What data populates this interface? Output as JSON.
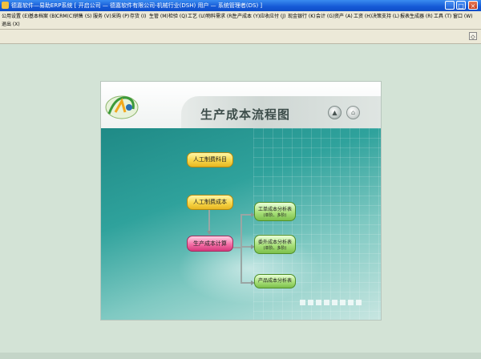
{
  "window": {
    "title": "德嘉软件—易助ERP系统   [ 开启公司 — 德嘉软件有限公司-机械行业(DSH)    用户 — 系统管理者(DS) ]",
    "buttons": [
      "_",
      "□",
      "×"
    ]
  },
  "menu": {
    "items": [
      "公用设置 (E)",
      "基本档案 (B)",
      "CRM(C)",
      "销售 (S)",
      "服务 (V)",
      "采购 (P)",
      "存货 (I)",
      "生管 (M)",
      "检验 (Q)",
      "工艺 (U)",
      "物料需求 (R)",
      "生产成本 (Y)",
      "应收应付 (J)",
      "现金银行 (K)",
      "会计 (G)",
      "资产 (A)",
      "工资 (H)",
      "决策支持 (L)",
      "报表生成器 (R)",
      "工具 (T)",
      "窗口 (W)"
    ],
    "items_row2": [
      "退出 (X)"
    ]
  },
  "panel": {
    "title": "生产成本流程图",
    "nodes": {
      "labor_subject": "人工制费科目",
      "labor_cost": "人工制费成本",
      "production_cost": "生产成本计算",
      "work_order_report": {
        "line1": "工单成本分析表",
        "line2": "(单阶、多阶)"
      },
      "process_report": {
        "line1": "委外成本分析表",
        "line2": "(单阶、多阶)"
      },
      "product_report": "产品成本分析表"
    },
    "nav": {
      "up": "▲",
      "home": "⌂"
    }
  },
  "colors": {
    "titlebar": "#1559d6",
    "workspace": "#d3e3d6",
    "panel_teal": "#2fa29c",
    "node_yellow": "#f7d64a",
    "node_pink": "#f46ea6",
    "node_green": "#a9e07a"
  }
}
